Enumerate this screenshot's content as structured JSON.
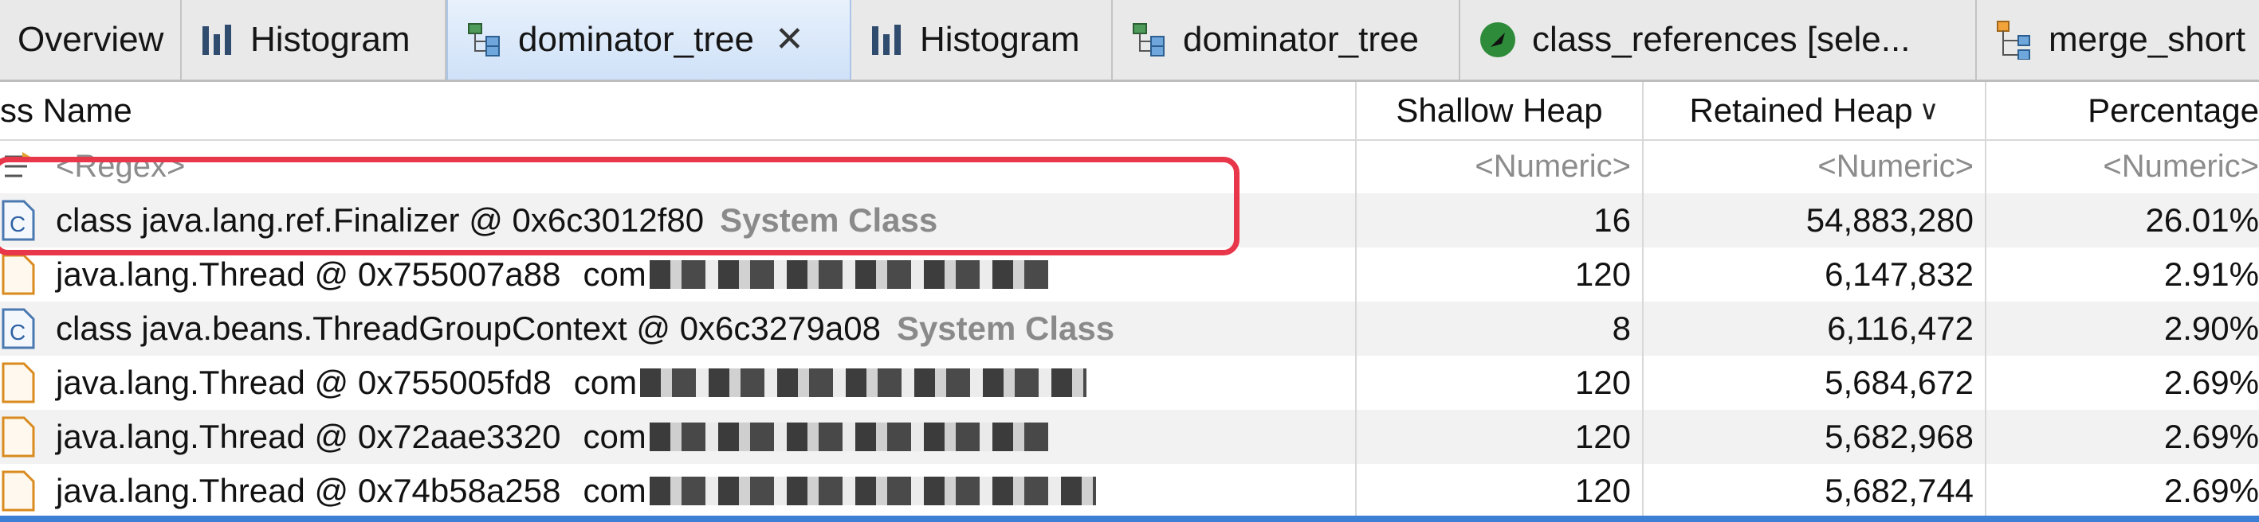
{
  "tabs": [
    {
      "label": "Overview",
      "icon": "overview-icon",
      "active": false
    },
    {
      "label": "Histogram",
      "icon": "histogram-icon",
      "active": false
    },
    {
      "label": "dominator_tree",
      "icon": "dominator-tree-icon",
      "active": true,
      "close": "✕"
    },
    {
      "label": "Histogram",
      "icon": "histogram-icon",
      "active": false
    },
    {
      "label": "dominator_tree",
      "icon": "dominator-tree-icon",
      "active": false
    },
    {
      "label": "class_references  [sele...",
      "icon": "class-references-icon",
      "active": false
    },
    {
      "label": "merge_short",
      "icon": "merge-shortest-paths-icon",
      "active": false
    }
  ],
  "columns": {
    "name": "ss Name",
    "shallow": "Shallow Heap",
    "retained": "Retained Heap",
    "retained_sort": "∨",
    "percentage": "Percentage"
  },
  "filter": {
    "name": "<Regex>",
    "shallow": "<Numeric>",
    "retained": "<Numeric>",
    "percentage": "<Numeric>"
  },
  "rows": [
    {
      "name": "class java.lang.ref.Finalizer @ 0x6c3012f80",
      "tag": "System Class",
      "extra": "",
      "shallow": "16",
      "retained": "54,883,280",
      "pct": "26.01%",
      "icon": "class-icon"
    },
    {
      "name": "java.lang.Thread @ 0x755007a88",
      "tag": "",
      "extra": "com",
      "shallow": "120",
      "retained": "6,147,832",
      "pct": "2.91%",
      "icon": "object-icon"
    },
    {
      "name": "class java.beans.ThreadGroupContext @ 0x6c3279a08",
      "tag": "System Class",
      "extra": "",
      "shallow": "8",
      "retained": "6,116,472",
      "pct": "2.90%",
      "icon": "class-icon"
    },
    {
      "name": "java.lang.Thread @ 0x755005fd8",
      "tag": "",
      "extra": "com",
      "shallow": "120",
      "retained": "5,684,672",
      "pct": "2.69%",
      "icon": "object-icon"
    },
    {
      "name": "java.lang.Thread @ 0x72aae3320",
      "tag": "",
      "extra": "com",
      "shallow": "120",
      "retained": "5,682,968",
      "pct": "2.69%",
      "icon": "object-icon"
    },
    {
      "name": "java.lang.Thread @ 0x74b58a258",
      "tag": "",
      "extra": "com",
      "shallow": "120",
      "retained": "5,682,744",
      "pct": "2.69%",
      "icon": "object-icon"
    }
  ],
  "colors": {
    "highlight": "#e8364a",
    "active_tab": "#cfe1f8",
    "selection_bar": "#3d7fd4"
  }
}
